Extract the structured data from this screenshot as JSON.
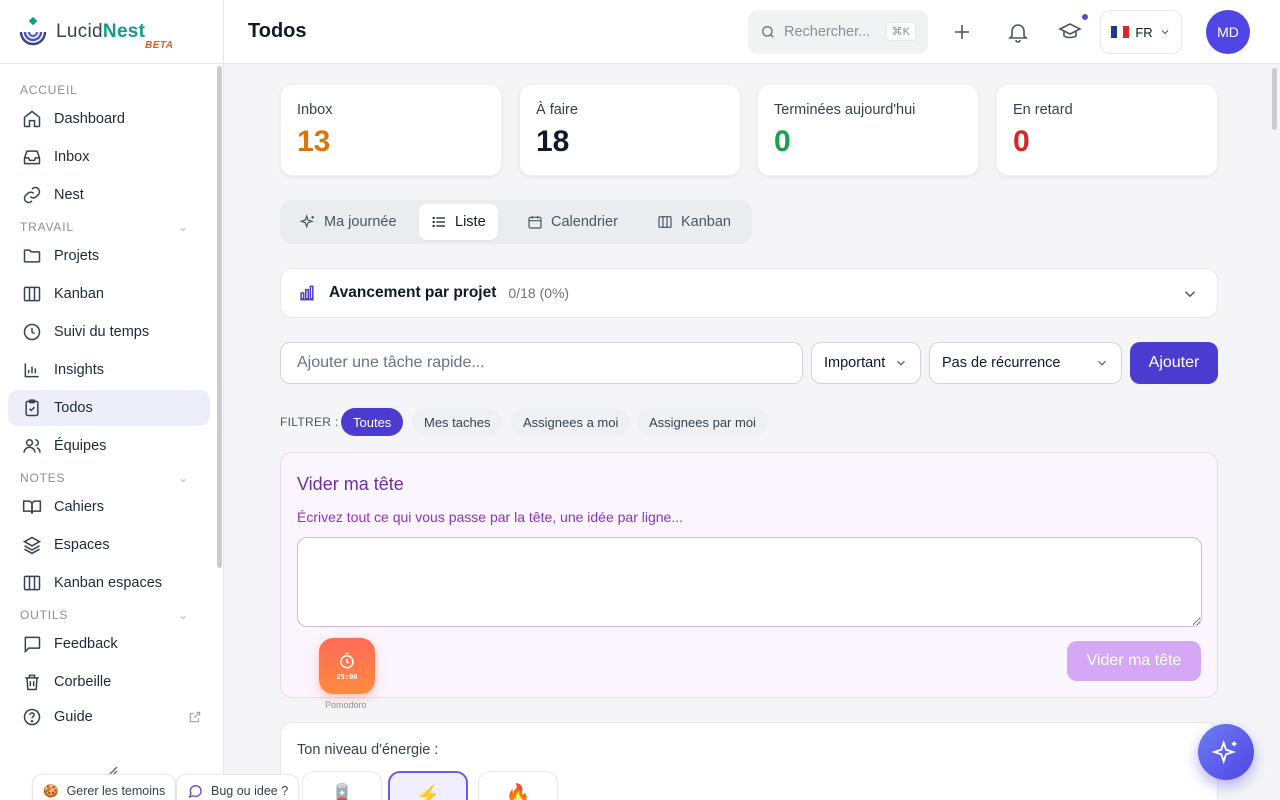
{
  "brand": {
    "name_part1": "Lucid",
    "name_part2": "Nest",
    "badge": "BETA"
  },
  "sidebar": {
    "sections": [
      {
        "title": "ACCUEIL",
        "items": [
          {
            "label": "Dashboard",
            "icon": "home-icon"
          },
          {
            "label": "Inbox",
            "icon": "inbox-icon"
          },
          {
            "label": "Nest",
            "icon": "link-icon"
          }
        ]
      },
      {
        "title": "TRAVAIL",
        "items": [
          {
            "label": "Projets",
            "icon": "folder-icon"
          },
          {
            "label": "Kanban",
            "icon": "kanban-icon"
          },
          {
            "label": "Suivi du temps",
            "icon": "clock-icon"
          },
          {
            "label": "Insights",
            "icon": "bar-chart-icon"
          },
          {
            "label": "Todos",
            "icon": "clipboard-check-icon",
            "active": true
          },
          {
            "label": "Équipes",
            "icon": "users-icon"
          }
        ]
      },
      {
        "title": "NOTES",
        "items": [
          {
            "label": "Cahiers",
            "icon": "book-open-icon"
          },
          {
            "label": "Espaces",
            "icon": "layers-icon"
          },
          {
            "label": "Kanban espaces",
            "icon": "kanban-icon"
          }
        ]
      },
      {
        "title": "OUTILS",
        "items": [
          {
            "label": "Feedback",
            "icon": "message-square-icon"
          },
          {
            "label": "Corbeille",
            "icon": "trash-icon"
          },
          {
            "label": "Guide",
            "icon": "help-circle-icon",
            "external": true
          }
        ]
      }
    ]
  },
  "header": {
    "title": "Todos",
    "search_placeholder": "Rechercher...",
    "search_shortcut": "⌘K",
    "language": "FR",
    "avatar_initials": "MD"
  },
  "stats": [
    {
      "label": "Inbox",
      "value": "13",
      "color": "#d97706"
    },
    {
      "label": "À faire",
      "value": "18",
      "color": "#111827"
    },
    {
      "label": "Terminées aujourd'hui",
      "value": "0",
      "color": "#16a34a"
    },
    {
      "label": "En retard",
      "value": "0",
      "color": "#dc2626"
    }
  ],
  "view_tabs": [
    {
      "label": "Ma journée",
      "icon": "sparkles-icon"
    },
    {
      "label": "Liste",
      "icon": "list-icon",
      "active": true
    },
    {
      "label": "Calendrier",
      "icon": "calendar-icon"
    },
    {
      "label": "Kanban",
      "icon": "kanban-icon"
    }
  ],
  "progress": {
    "title": "Avancement par projet",
    "count": "0/18 (0%)"
  },
  "quick_add": {
    "placeholder": "Ajouter une tâche rapide...",
    "priority": "Important",
    "recurrence": "Pas de récurrence",
    "submit": "Ajouter"
  },
  "filter": {
    "label": "FILTRER :",
    "chips": [
      "Toutes",
      "Mes taches",
      "Assignees a moi",
      "Assignees par moi"
    ],
    "active": "Toutes"
  },
  "brain_dump": {
    "title": "Vider ma tête",
    "subtitle": "Écrivez tout ce qui vous passe par la tête, une idée par ligne...",
    "button": "Vider ma tête"
  },
  "pomodoro": {
    "time": "25:00",
    "label": "Pomodoro"
  },
  "energy": {
    "title": "Ton niveau d'énergie :",
    "levels": [
      "🪫",
      "⚡",
      "🔥"
    ],
    "active_index": 1
  },
  "footer": {
    "cookies": "Gerer les temoins",
    "feedback": "Bug ou idee ?"
  },
  "colors": {
    "accent": "#4c3bcf",
    "brand_teal": "#0f9b8e",
    "active_bg": "#eeeefb"
  }
}
